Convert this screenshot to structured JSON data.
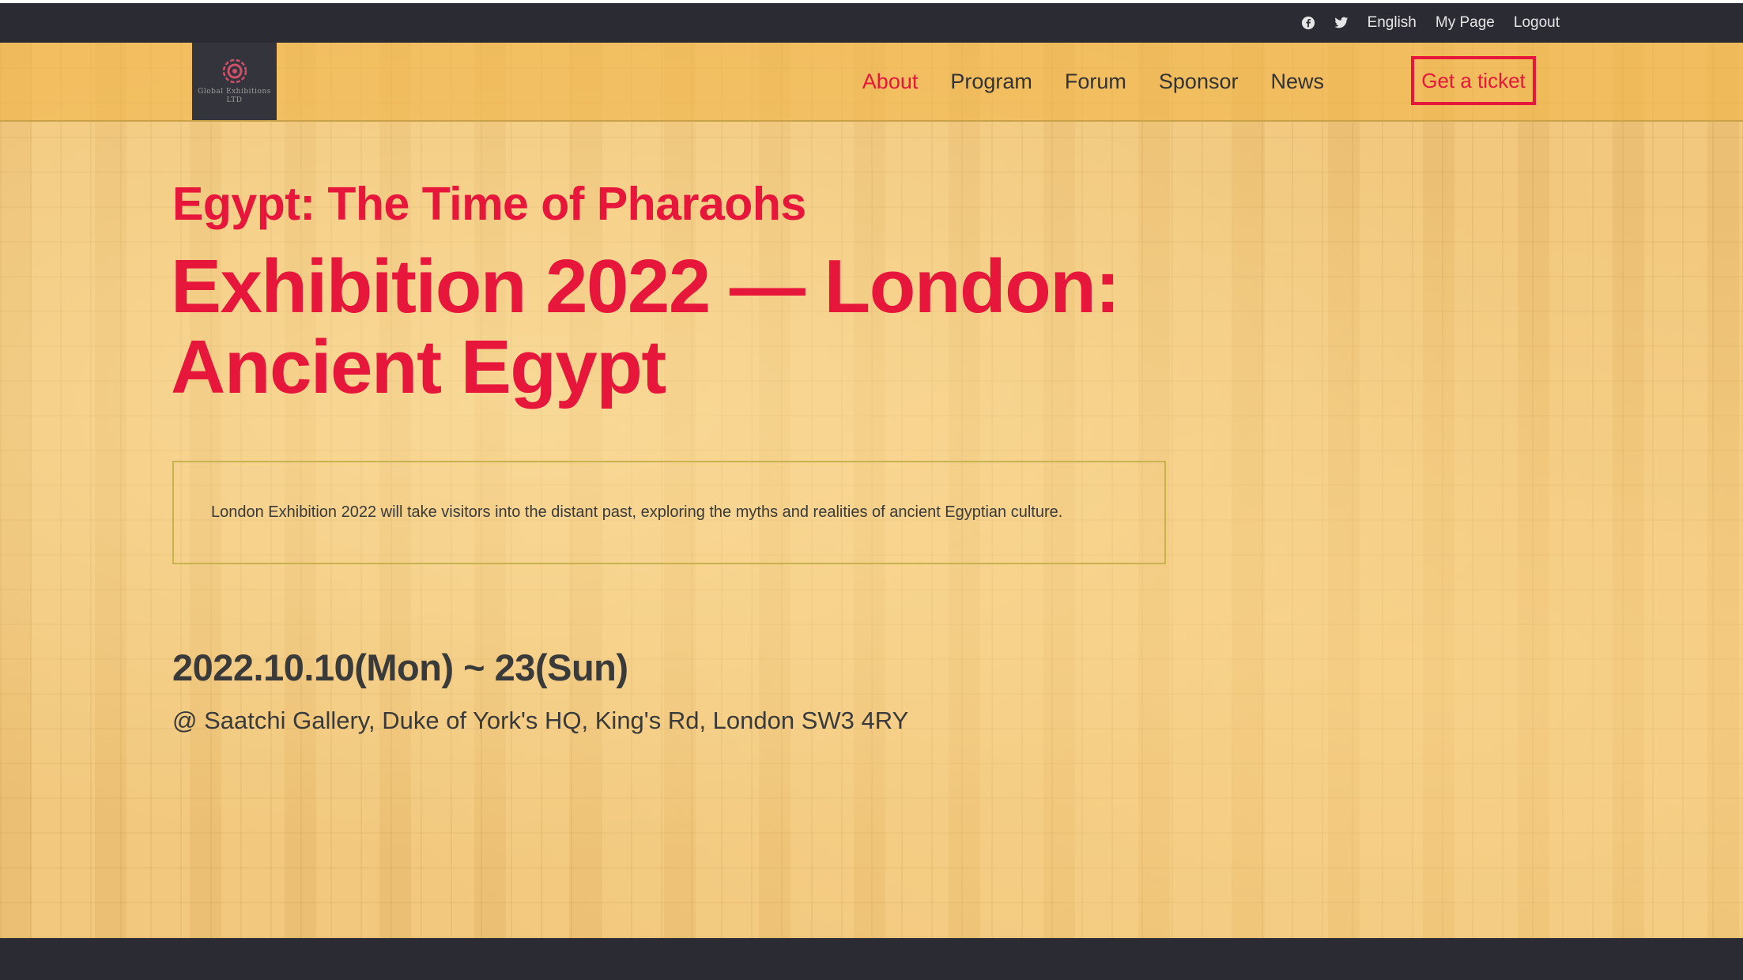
{
  "topbar": {
    "icons": [
      "facebook-icon",
      "twitter-icon"
    ],
    "language": "English",
    "my_page": "My Page",
    "logout": "Logout"
  },
  "logo": {
    "text_line1": "Global Exhibitions",
    "text_line2": "LTD"
  },
  "nav": {
    "items": [
      {
        "label": "About",
        "active": true
      },
      {
        "label": "Program",
        "active": false
      },
      {
        "label": "Forum",
        "active": false
      },
      {
        "label": "Sponsor",
        "active": false
      },
      {
        "label": "News",
        "active": false
      }
    ],
    "cta": "Get a ticket"
  },
  "hero": {
    "subtitle": "Egypt: The Time of Pharaohs",
    "title_line1": "Exhibition 2022 — London:",
    "title_line2": "Ancient Egypt",
    "description": "London Exhibition 2022 will take visitors into the distant past, exploring the myths and realities of ancient Egyptian culture.",
    "dates": "2022.10.10(Mon) ~ 23(Sun)",
    "venue": "@ Saatchi Gallery, Duke of York's HQ, King's Rd, London SW3 4RY"
  },
  "colors": {
    "accent": "#e6173b",
    "dark": "#2b2b33",
    "papyrus": "#f0c67a"
  }
}
